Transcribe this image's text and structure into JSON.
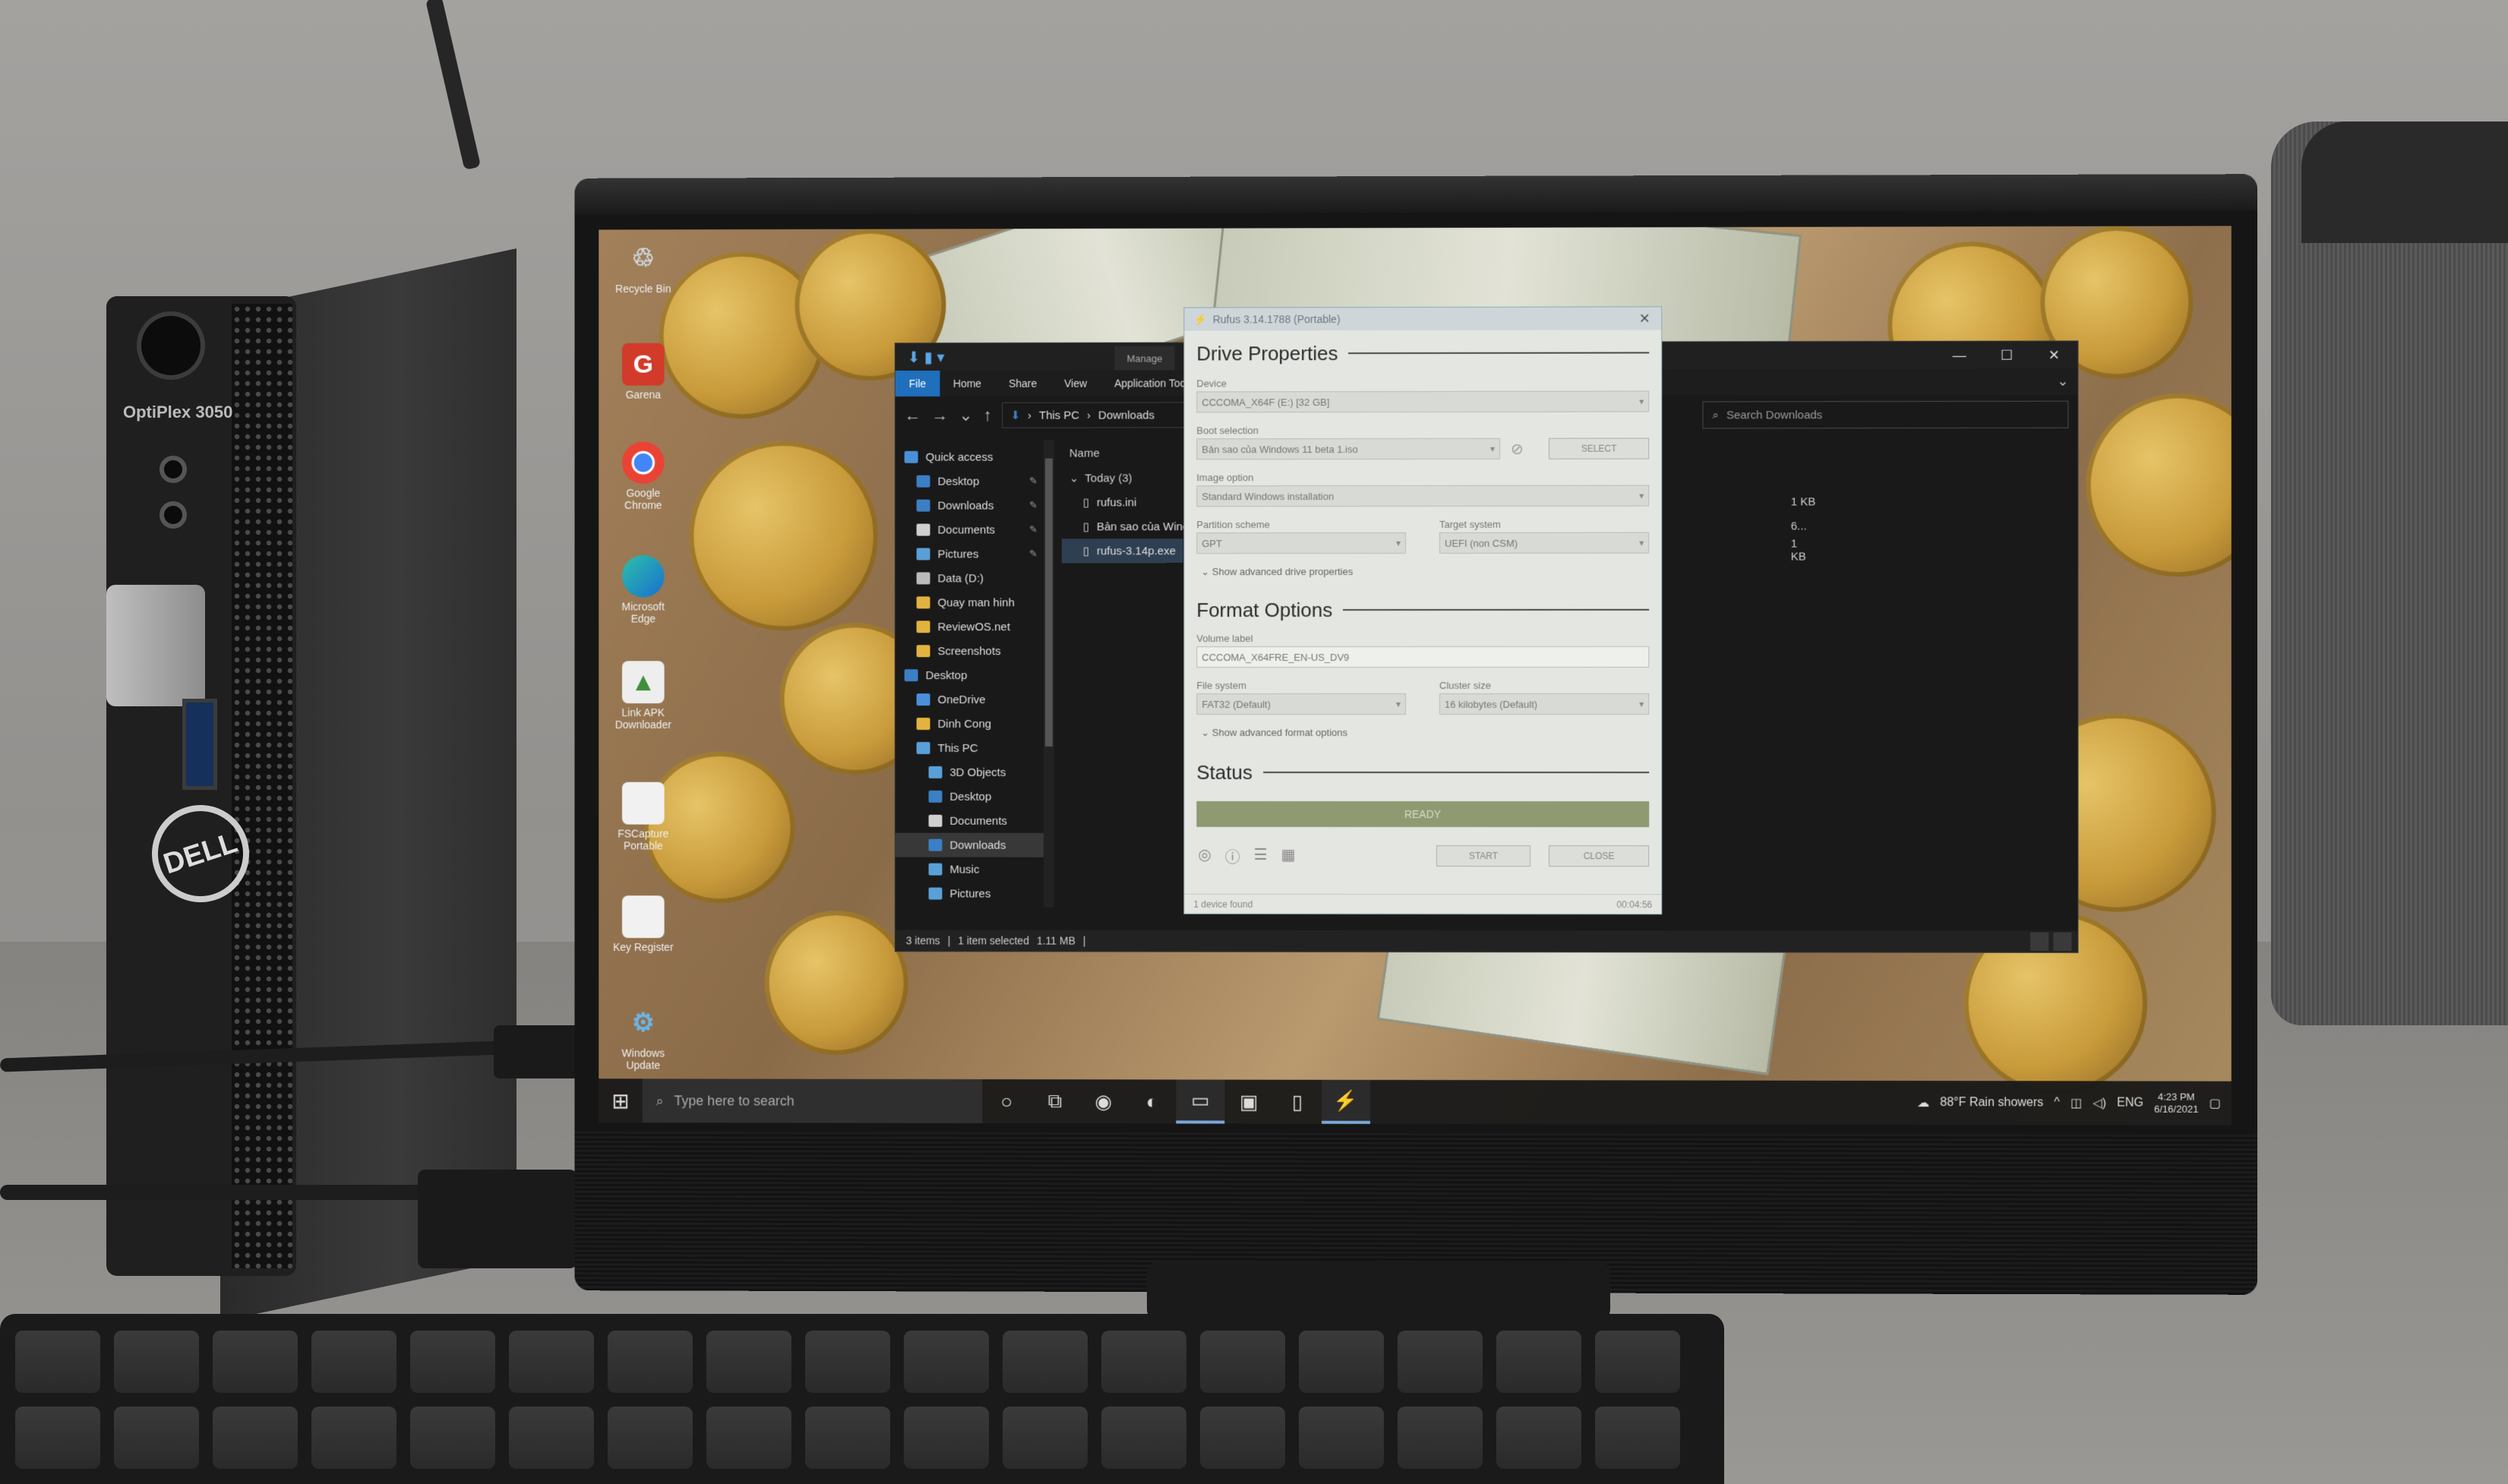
{
  "scene": {
    "pc_model": "OptiPlex 3050",
    "pc_brand": "DELL"
  },
  "desktop": {
    "icons": [
      {
        "label": "Recycle Bin",
        "icon": "recycle-bin-icon"
      },
      {
        "label": "Garena",
        "icon": "garena-icon"
      },
      {
        "label": "Google Chrome",
        "icon": "chrome-icon"
      },
      {
        "label": "Microsoft Edge",
        "icon": "edge-icon"
      },
      {
        "label": "Link APK Downloader",
        "icon": "app-icon"
      },
      {
        "label": "FSCapture Portable",
        "icon": "file-icon"
      },
      {
        "label": "Key Register",
        "icon": "file-icon"
      },
      {
        "label": "Windows Update",
        "icon": "settings-icon"
      }
    ]
  },
  "explorer": {
    "context_tab": "Manage",
    "ribbon_tabs": [
      "File",
      "Home",
      "Share",
      "View",
      "Application Tools"
    ],
    "breadcrumb": [
      "This PC",
      "Downloads"
    ],
    "search_placeholder": "Search Downloads",
    "nav": [
      {
        "label": "Quick access",
        "icon": "star-icon",
        "color": "#4a90d9",
        "pinned": false,
        "selected": false
      },
      {
        "label": "Desktop",
        "icon": "desktop-icon",
        "color": "#3b7fc4",
        "pinned": true,
        "selected": false
      },
      {
        "label": "Downloads",
        "icon": "download-icon",
        "color": "#3b7fc4",
        "pinned": true,
        "selected": false
      },
      {
        "label": "Documents",
        "icon": "documents-icon",
        "color": "#cfcfcf",
        "pinned": true,
        "selected": false
      },
      {
        "label": "Pictures",
        "icon": "pictures-icon",
        "color": "#5aa0d8",
        "pinned": true,
        "selected": false
      },
      {
        "label": "Data (D:)",
        "icon": "drive-icon",
        "color": "#bbbbbb",
        "pinned": false,
        "selected": false
      },
      {
        "label": "Quay man hinh",
        "icon": "folder-icon",
        "color": "#e3b341",
        "pinned": false,
        "selected": false
      },
      {
        "label": "ReviewOS.net",
        "icon": "folder-icon",
        "color": "#e3b341",
        "pinned": false,
        "selected": false
      },
      {
        "label": "Screenshots",
        "icon": "folder-icon",
        "color": "#e3b341",
        "pinned": false,
        "selected": false
      },
      {
        "label": "Desktop",
        "icon": "desktop-icon",
        "color": "#3b7fc4",
        "pinned": false,
        "selected": false
      },
      {
        "label": "OneDrive",
        "icon": "cloud-icon",
        "color": "#4a90d9",
        "pinned": false,
        "selected": false
      },
      {
        "label": "Dinh Cong",
        "icon": "user-folder-icon",
        "color": "#e3b341",
        "pinned": false,
        "selected": false
      },
      {
        "label": "This PC",
        "icon": "computer-icon",
        "color": "#5aa0d8",
        "pinned": false,
        "selected": false
      },
      {
        "label": "3D Objects",
        "icon": "cube-icon",
        "color": "#5aa0d8",
        "pinned": false,
        "selected": false
      },
      {
        "label": "Desktop",
        "icon": "desktop-icon",
        "color": "#3b7fc4",
        "pinned": false,
        "selected": false
      },
      {
        "label": "Documents",
        "icon": "documents-icon",
        "color": "#cfcfcf",
        "pinned": false,
        "selected": false
      },
      {
        "label": "Downloads",
        "icon": "download-icon",
        "color": "#3b7fc4",
        "pinned": false,
        "selected": true
      },
      {
        "label": "Music",
        "icon": "music-icon",
        "color": "#5aa0d8",
        "pinned": false,
        "selected": false
      },
      {
        "label": "Pictures",
        "icon": "pictures-icon",
        "color": "#5aa0d8",
        "pinned": false,
        "selected": false
      }
    ],
    "column_name": "Name",
    "group_label": "Today (3)",
    "files": [
      {
        "name": "rufus.ini",
        "size": "1 KB",
        "selected": false
      },
      {
        "name": "Bản sao của Wind",
        "size": "6...",
        "selected": false
      },
      {
        "name": "rufus-3.14p.exe",
        "size": "1 KB",
        "selected": true
      }
    ],
    "status": {
      "items": "3 items",
      "selected": "1 item selected",
      "size": "1.11 MB"
    }
  },
  "rufus": {
    "title": "Rufus 3.14.1788 (Portable)",
    "drive_properties_heading": "Drive Properties",
    "device_label": "Device",
    "device_value": "CCCOMA_X64F (E:) [32 GB]",
    "boot_selection_label": "Boot selection",
    "boot_selection_value": "Bản sao của Windows 11 beta 1.iso",
    "select_button": "SELECT",
    "image_option_label": "Image option",
    "image_option_value": "Standard Windows installation",
    "partition_scheme_label": "Partition scheme",
    "partition_scheme_value": "GPT",
    "target_system_label": "Target system",
    "target_system_value": "UEFI (non CSM)",
    "advanced_drive_link": "Show advanced drive properties",
    "format_options_heading": "Format Options",
    "volume_label_label": "Volume label",
    "volume_label_value": "CCCOMA_X64FRE_EN-US_DV9",
    "file_system_label": "File system",
    "file_system_value": "FAT32 (Default)",
    "cluster_size_label": "Cluster size",
    "cluster_size_value": "16 kilobytes (Default)",
    "advanced_format_link": "Show advanced format options",
    "status_heading": "Status",
    "progress_text": "READY",
    "progress_fraction": 1.0,
    "start_button": "START",
    "close_button": "CLOSE",
    "footer_left": "1 device found",
    "footer_right": "00:04:56"
  },
  "taskbar": {
    "search_placeholder": "Type here to search",
    "apps": [
      {
        "icon": "cortana-icon",
        "glyph": "○"
      },
      {
        "icon": "task-view-icon",
        "glyph": "⧉"
      },
      {
        "icon": "chrome-icon",
        "glyph": "◉"
      },
      {
        "icon": "edge-icon",
        "glyph": "◐"
      },
      {
        "icon": "file-explorer-icon",
        "glyph": "▭"
      },
      {
        "icon": "store-icon",
        "glyph": "▣"
      },
      {
        "icon": "notepad-icon",
        "glyph": "▯"
      },
      {
        "icon": "rufus-icon",
        "glyph": "⚡"
      }
    ],
    "weather": "88°F Rain showers",
    "language": "ENG",
    "time": "4:23 PM",
    "date": "6/16/2021"
  }
}
